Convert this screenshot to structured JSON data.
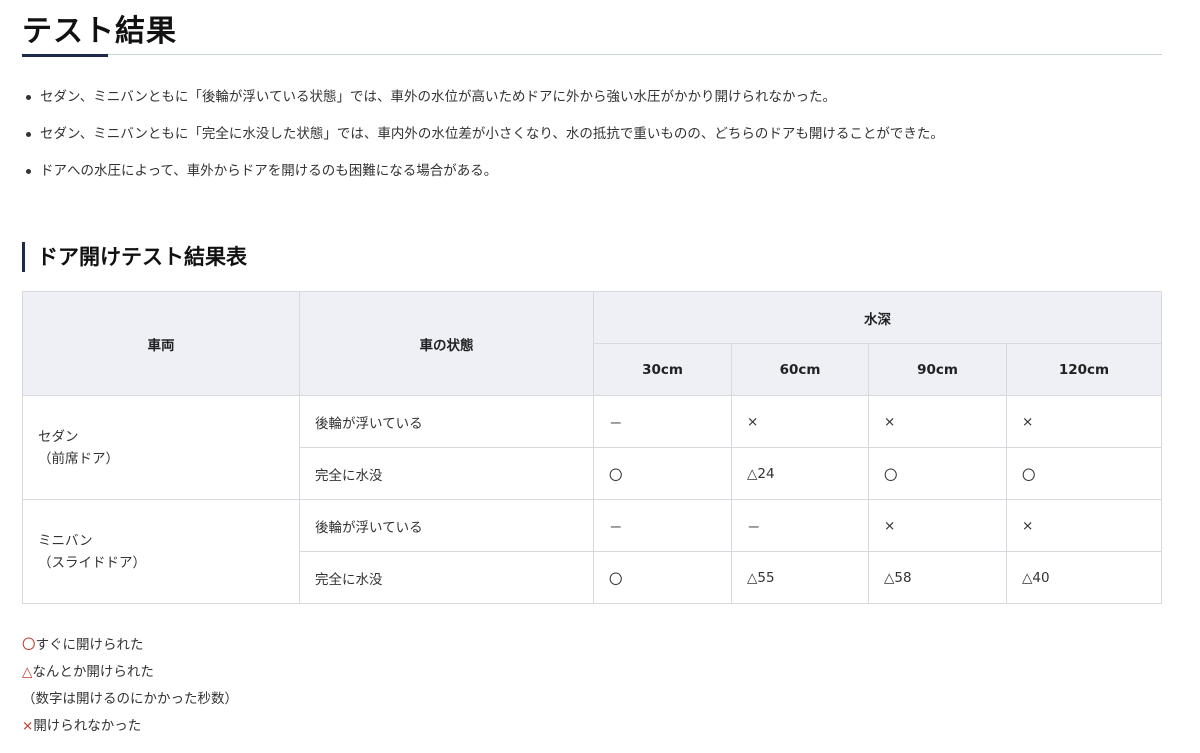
{
  "page_title": "テスト結果",
  "bullets": [
    "セダン、ミニバンともに「後輪が浮いている状態」では、車外の水位が高いためドアに外から強い水圧がかかり開けられなかった。",
    "セダン、ミニバンともに「完全に水没した状態」では、車内外の水位差が小さくなり、水の抵抗で重いものの、どちらのドアも開けることができた。",
    "ドアへの水圧によって、車外からドアを開けるのも困難になる場合がある。"
  ],
  "section_title": "ドア開けテスト結果表",
  "table": {
    "headers": {
      "vehicle": "車両",
      "condition": "車の状態",
      "depth": "水深",
      "depths": [
        "30cm",
        "60cm",
        "90cm",
        "120cm"
      ]
    },
    "rows": [
      {
        "vehicle_line1": "セダン",
        "vehicle_line2": "（前席ドア）",
        "conditions": [
          {
            "label": "後輪が浮いている",
            "cells": [
              "－",
              "×",
              "×",
              "×"
            ]
          },
          {
            "label": "完全に水没",
            "cells": [
              "〇",
              "△24",
              "〇",
              "〇"
            ]
          }
        ]
      },
      {
        "vehicle_line1": "ミニバン",
        "vehicle_line2": "（スライドドア）",
        "conditions": [
          {
            "label": "後輪が浮いている",
            "cells": [
              "－",
              "－",
              "×",
              "×"
            ]
          },
          {
            "label": "完全に水没",
            "cells": [
              "〇",
              "△55",
              "△58",
              "△40"
            ]
          }
        ]
      }
    ]
  },
  "legend": {
    "circle_symbol": "〇",
    "circle_text": "すぐに開けられた",
    "triangle_symbol": "△",
    "triangle_text": "なんとか開けられた",
    "triangle_note": "（数字は開けるのにかかった秒数）",
    "cross_symbol": "×",
    "cross_text": "開けられなかった"
  },
  "colors": {
    "accent": "#1e2a4a",
    "header_bg": "#eef0f6",
    "result_red": "#c0392b",
    "border": "#d6d9dd"
  }
}
